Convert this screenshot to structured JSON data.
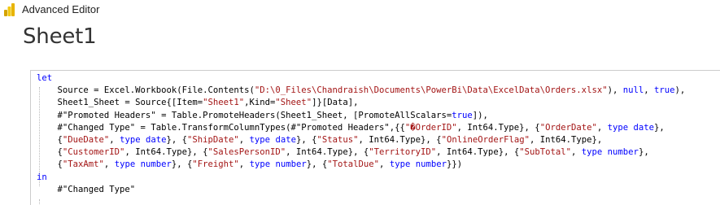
{
  "window": {
    "title": "Advanced Editor"
  },
  "query": {
    "name": "Sheet1"
  },
  "code": {
    "lines": [
      [
        [
          "kw",
          "let"
        ]
      ],
      [
        [
          "t",
          "    Source = Excel.Workbook(File.Contents("
        ],
        [
          "str",
          "\"D:\\0_Files\\Chandraish\\Documents\\PowerBi\\Data\\ExcelData\\Orders.xlsx\""
        ],
        [
          "t",
          "), "
        ],
        [
          "kw",
          "null"
        ],
        [
          "t",
          ", "
        ],
        [
          "kw",
          "true"
        ],
        [
          "t",
          "),"
        ]
      ],
      [
        [
          "t",
          "    Sheet1_Sheet = Source{[Item="
        ],
        [
          "str",
          "\"Sheet1\""
        ],
        [
          "t",
          ",Kind="
        ],
        [
          "str",
          "\"Sheet\""
        ],
        [
          "t",
          "]}[Data],"
        ]
      ],
      [
        [
          "t",
          "    #\"Promoted Headers\" = Table.PromoteHeaders(Sheet1_Sheet, [PromoteAllScalars="
        ],
        [
          "kw",
          "true"
        ],
        [
          "t",
          "]),"
        ]
      ],
      [
        [
          "t",
          "    #\"Changed Type\" = Table.TransformColumnTypes(#\"Promoted Headers\",{{"
        ],
        [
          "str",
          "\"�OrderID\""
        ],
        [
          "t",
          ", Int64.Type}, {"
        ],
        [
          "str",
          "\"OrderDate\""
        ],
        [
          "t",
          ", "
        ],
        [
          "kw",
          "type"
        ],
        [
          "t",
          " "
        ],
        [
          "kw",
          "date"
        ],
        [
          "t",
          "},"
        ]
      ],
      [
        [
          "t",
          "    {"
        ],
        [
          "str",
          "\"DueDate\""
        ],
        [
          "t",
          ", "
        ],
        [
          "kw",
          "type"
        ],
        [
          "t",
          " "
        ],
        [
          "kw",
          "date"
        ],
        [
          "t",
          "}, {"
        ],
        [
          "str",
          "\"ShipDate\""
        ],
        [
          "t",
          ", "
        ],
        [
          "kw",
          "type"
        ],
        [
          "t",
          " "
        ],
        [
          "kw",
          "date"
        ],
        [
          "t",
          "}, {"
        ],
        [
          "str",
          "\"Status\""
        ],
        [
          "t",
          ", Int64.Type}, {"
        ],
        [
          "str",
          "\"OnlineOrderFlag\""
        ],
        [
          "t",
          ", Int64.Type},"
        ]
      ],
      [
        [
          "t",
          "    {"
        ],
        [
          "str",
          "\"CustomerID\""
        ],
        [
          "t",
          ", Int64.Type}, {"
        ],
        [
          "str",
          "\"SalesPersonID\""
        ],
        [
          "t",
          ", Int64.Type}, {"
        ],
        [
          "str",
          "\"TerritoryID\""
        ],
        [
          "t",
          ", Int64.Type}, {"
        ],
        [
          "str",
          "\"SubTotal\""
        ],
        [
          "t",
          ", "
        ],
        [
          "kw",
          "type"
        ],
        [
          "t",
          " "
        ],
        [
          "kw",
          "number"
        ],
        [
          "t",
          "},"
        ]
      ],
      [
        [
          "t",
          "    {"
        ],
        [
          "str",
          "\"TaxAmt\""
        ],
        [
          "t",
          ", "
        ],
        [
          "kw",
          "type"
        ],
        [
          "t",
          " "
        ],
        [
          "kw",
          "number"
        ],
        [
          "t",
          "}, {"
        ],
        [
          "str",
          "\"Freight\""
        ],
        [
          "t",
          ", "
        ],
        [
          "kw",
          "type"
        ],
        [
          "t",
          " "
        ],
        [
          "kw",
          "number"
        ],
        [
          "t",
          "}, {"
        ],
        [
          "str",
          "\"TotalDue\""
        ],
        [
          "t",
          ", "
        ],
        [
          "kw",
          "type"
        ],
        [
          "t",
          " "
        ],
        [
          "kw",
          "number"
        ],
        [
          "t",
          "}})"
        ]
      ],
      [
        [
          "kw",
          "in"
        ]
      ],
      [
        [
          "t",
          "    #\"Changed Type\""
        ]
      ]
    ]
  },
  "colors": {
    "keyword": "#0000ff",
    "string": "#a31515",
    "text": "#000000"
  },
  "icons": {
    "app": "powerbi-logo-icon"
  }
}
